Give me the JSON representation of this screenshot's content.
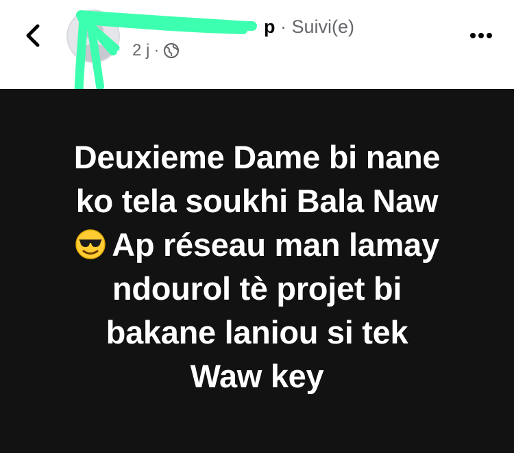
{
  "header": {
    "author_name": "",
    "name_suffix": "p",
    "follow_status": "· Suivi(e)",
    "time_ago": "2 j",
    "separator": "·",
    "audience_icon": "globe-icon",
    "back_icon": "chevron-left-icon",
    "more_icon": "more-horizontal-icon"
  },
  "post": {
    "lines": [
      "Deuxieme Dame bi nane",
      "ko tela soukhi Bala Naw",
      "Ap réseau man lamay",
      "ndourol tè projet bi",
      "bakane laniou si tek",
      "Waw key"
    ],
    "emoji": "smiling-face-with-sunglasses-icon"
  },
  "colors": {
    "post_background": "#121212",
    "post_text": "#ffffff",
    "meta_text": "#65676b",
    "redaction_stroke": "#3dffb0"
  }
}
